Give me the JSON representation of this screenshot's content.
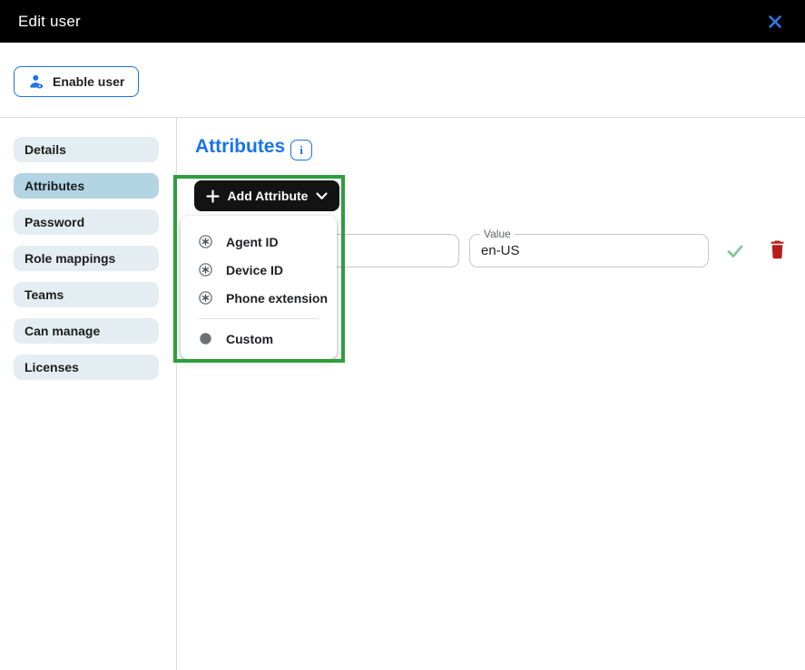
{
  "header": {
    "title": "Edit user",
    "close_icon": "close-icon"
  },
  "toolbar": {
    "enable_user": {
      "label": "Enable user",
      "icon": "person-eye-icon"
    }
  },
  "sidebar": {
    "items": [
      {
        "label": "Details",
        "active": false
      },
      {
        "label": "Attributes",
        "active": true
      },
      {
        "label": "Password",
        "active": false
      },
      {
        "label": "Role mappings",
        "active": false
      },
      {
        "label": "Teams",
        "active": false
      },
      {
        "label": "Can manage",
        "active": false
      },
      {
        "label": "Licenses",
        "active": false
      }
    ]
  },
  "main": {
    "heading": "Attributes",
    "info_icon_glyph": "i",
    "add_attribute_button": {
      "label": "Add Attribute",
      "left_icon": "plus-icon",
      "right_icon": "chevron-down-icon"
    },
    "menu": {
      "items": [
        {
          "label": "Agent ID",
          "icon": "asterisk-circle-icon"
        },
        {
          "label": "Device ID",
          "icon": "asterisk-circle-icon"
        },
        {
          "label": "Phone extension",
          "icon": "asterisk-circle-icon"
        },
        {
          "label": "Custom",
          "icon": "filled-circle-icon"
        }
      ]
    },
    "attribute_row": {
      "name_field": {
        "value": ""
      },
      "value_field": {
        "label": "Value",
        "value": "en-US"
      },
      "confirm_icon": "check-icon",
      "delete_icon": "trash-icon"
    }
  },
  "annotation": {
    "highlight_color": "#2d9e3c"
  },
  "colors": {
    "accent_blue": "#1a73e8",
    "header_bg": "#000000",
    "sidebar_item_bg": "#e4edf1",
    "sidebar_item_active_bg": "#b3d4e3",
    "add_button_bg": "#131313",
    "annotation_green": "#2d9e3c",
    "check_green": "#84c796",
    "delete_red": "#b71c1c"
  }
}
